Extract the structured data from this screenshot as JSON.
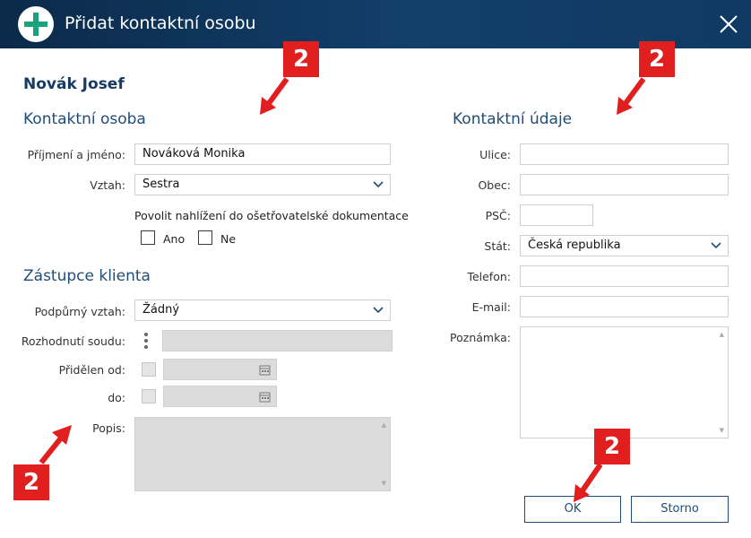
{
  "window": {
    "title": "Přidat kontaktní osobu",
    "close_label": "Zavřít"
  },
  "client": {
    "name": "Novák Josef"
  },
  "contact_person": {
    "section_title": "Kontaktní osoba",
    "surname_label": "Příjmení a jméno:",
    "surname_value": "Nováková Monika",
    "relation_label": "Vztah:",
    "relation_value": "Sestra",
    "allow_access_text": "Povolit nahlížení do ošetřovatelské dokumentace",
    "yes_label": "Ano",
    "no_label": "Ne"
  },
  "client_representative": {
    "section_title": "Zástupce klienta",
    "support_label": "Podpůrný vztah:",
    "support_value": "Žádný",
    "court_label": "Rozhodnutí soudu:",
    "assigned_from_label": "Přidělen od:",
    "to_label": "do:",
    "description_label": "Popis:"
  },
  "contact_details": {
    "section_title": "Kontaktní údaje",
    "street_label": "Ulice:",
    "city_label": "Obec:",
    "zip_label": "PSČ:",
    "country_label": "Stát:",
    "country_value": "Česká republika",
    "phone_label": "Telefon:",
    "email_label": "E-mail:",
    "note_label": "Poznámka:"
  },
  "buttons": {
    "ok": "OK",
    "cancel": "Storno"
  },
  "annotations": {
    "marker_text": "2"
  },
  "colors": {
    "accent": "#1f4d7a",
    "titlebar": "#0f3a63",
    "marker": "#e21f1f",
    "plus_icon": "#1aa37a"
  }
}
